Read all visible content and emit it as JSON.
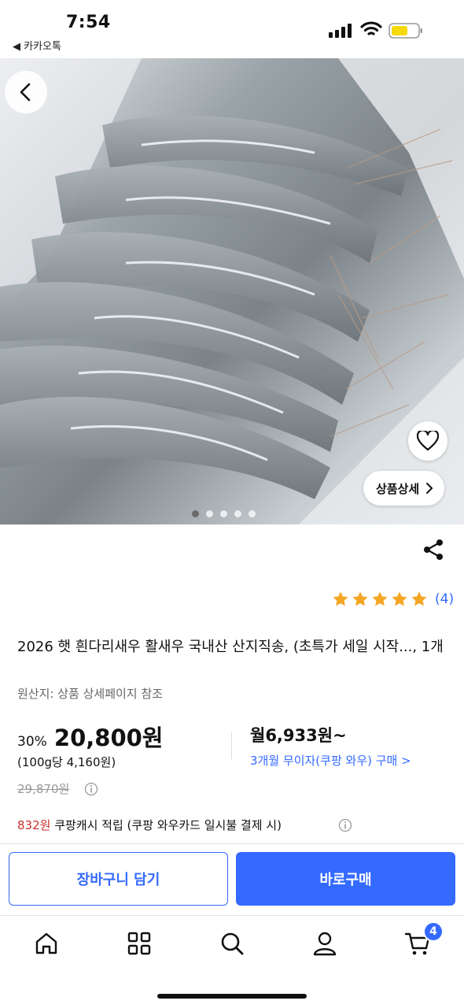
{
  "status_bar": {
    "time": "7:54",
    "back_app_label": "◀ 카카오톡"
  },
  "hero": {
    "detail_label": "상품상세",
    "image_count": 5,
    "active_image": 1
  },
  "rating": {
    "stars": 5,
    "count_label": "(4)",
    "star_color": "#f5a623"
  },
  "product": {
    "title": "2026 햇 흰다리새우 활새우 국내산 산지직송, (초특가 세일 시작..., 1개",
    "origin": "원산지: 상품 상세페이지 참조",
    "discount": "30%",
    "sale_price": "20,800원",
    "unit_price": "(100g당 4,160원)",
    "original_price": "29,870원",
    "monthly_price": "월6,933원~",
    "installment": "3개월 무이자(쿠팡 와우) 구매 >",
    "cash_amount": "832원",
    "cash_text": " 쿠팡캐시 적립 (쿠팡 와우카드 일시불 결제 시)"
  },
  "actions": {
    "cart_label": "장바구니 담기",
    "buy_label": "바로구매"
  },
  "tabbar": {
    "items": [
      "home-icon",
      "categories-icon",
      "search-icon",
      "profile-icon",
      "cart-icon"
    ],
    "cart_badge": "4"
  },
  "colors": {
    "accent": "#346aff",
    "cash_red": "#c9302c"
  }
}
